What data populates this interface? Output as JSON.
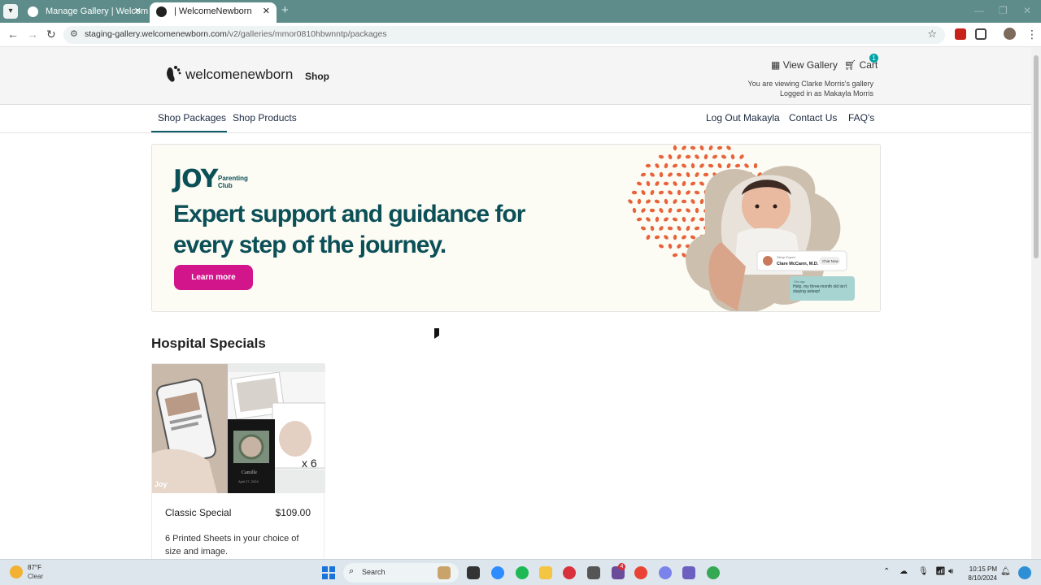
{
  "browser": {
    "tabs": [
      {
        "title": "Manage Gallery | WelcomeNew"
      },
      {
        "title": "| WelcomeNewborn"
      }
    ],
    "url_host": "staging-gallery.welcomenewborn.com",
    "url_path": "/v2/galleries/mmor0810hbwnntp/packages"
  },
  "header": {
    "logo_text": "welcomenewborn",
    "shop_label": "Shop",
    "view_gallery_label": "View Gallery",
    "cart_label": "Cart",
    "cart_count": "1",
    "viewing_line": "You are viewing Clarke Morris's gallery",
    "logged_in_line": "Logged in as Makayla Morris"
  },
  "subnav": {
    "shop_packages": "Shop Packages",
    "shop_products": "Shop Products",
    "log_out": "Log Out Makayla",
    "contact_us": "Contact Us",
    "faqs": "FAQ's"
  },
  "banner": {
    "brand": "JOY",
    "brand_sub_1": "Parenting",
    "brand_sub_2": "Club",
    "headline": "Expert support and guidance for every step of the journey.",
    "cta": "Learn more",
    "chat_role": "Sleep Expert",
    "chat_name": "Clare McCann, M.D.",
    "chat_button": "Chat Now",
    "chat_message_time": "10m ago",
    "chat_message": "Help, my three-month old isn't staying asleep!"
  },
  "section": {
    "title": "Hospital Specials"
  },
  "products": [
    {
      "name": "Classic Special",
      "price": "$109.00",
      "description": "6 Printed Sheets in your choice of size and image.",
      "badge": "x 6",
      "watermark": "Joy",
      "print_name": "Camille",
      "print_date": "April 27, 2024"
    }
  ],
  "taskbar": {
    "temperature": "87°F",
    "condition": "Clear",
    "search_label": "Search",
    "time": "10:15 PM",
    "date": "8/10/2024",
    "slack_badge": "4"
  },
  "colors": {
    "tabbar": "#5d8c8a",
    "brand_teal": "#0b4f57",
    "cta_pink": "#d3158c",
    "cart_badge": "#00a3a8",
    "dots_orange": "#e8633a"
  }
}
